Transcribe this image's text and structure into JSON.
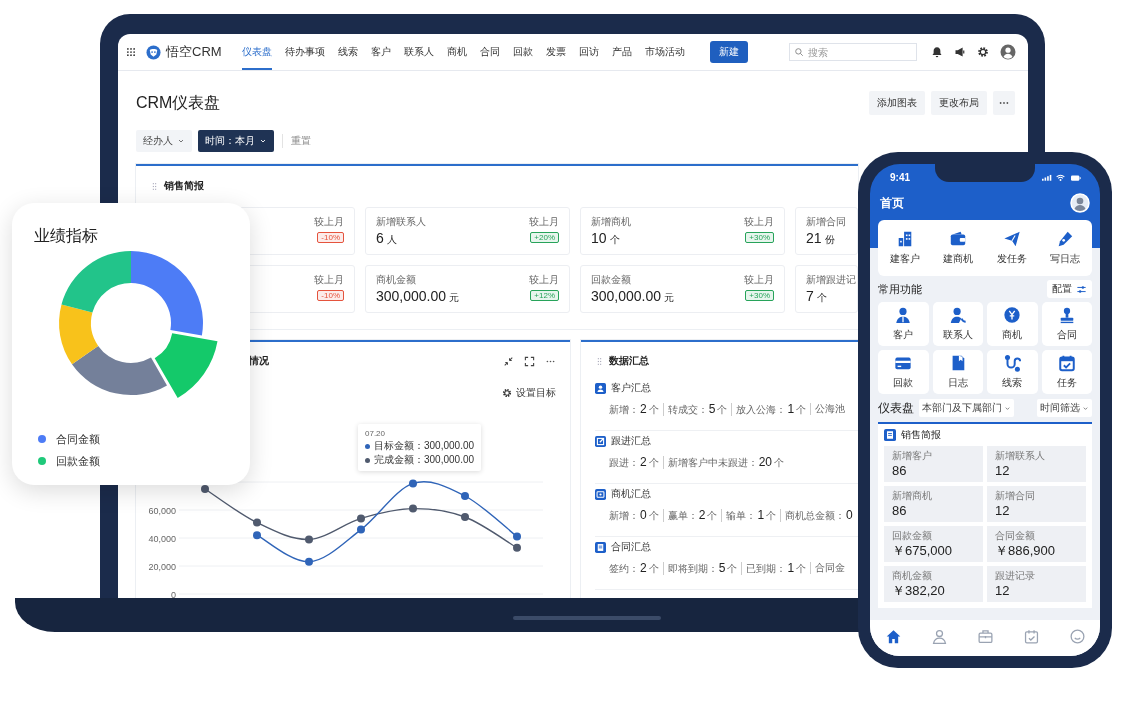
{
  "laptop": {
    "nav": {
      "app_name": "悟空CRM",
      "items": [
        {
          "label": "仪表盘",
          "selected": true
        },
        {
          "label": "待办事项",
          "selected": false
        },
        {
          "label": "线索",
          "selected": false
        },
        {
          "label": "客户",
          "selected": false
        },
        {
          "label": "联系人",
          "selected": false
        },
        {
          "label": "商机",
          "selected": false
        },
        {
          "label": "合同",
          "selected": false
        },
        {
          "label": "回款",
          "selected": false
        },
        {
          "label": "发票",
          "selected": false
        },
        {
          "label": "回访",
          "selected": false
        },
        {
          "label": "产品",
          "selected": false
        },
        {
          "label": "市场活动",
          "selected": false
        }
      ],
      "new_button": "新建",
      "search": {
        "placeholder": "搜索"
      }
    },
    "page": {
      "title": "CRM仪表盘",
      "actions": [
        "添加图表",
        "更改布局"
      ],
      "filters": [
        {
          "label": "经办人",
          "selected": false
        },
        {
          "label": "时间：本月",
          "selected": true
        }
      ],
      "reset": "重置"
    },
    "sales_report": {
      "title": "销售简报",
      "cards": [
        {
          "compare": "较上月",
          "change": "-10%",
          "color": "#e5533d"
        },
        {
          "title": "新增联系人",
          "value": "6",
          "unit": "人",
          "compare": "较上月",
          "change": "+20%",
          "color": "#27a35a"
        },
        {
          "title": "新增商机",
          "value": "10",
          "unit": "个",
          "compare": "较上月",
          "change": "+30%",
          "color": "#27a35a"
        },
        {
          "title": "新增合同",
          "value": "21",
          "unit": "份"
        },
        {
          "compare": "较上月",
          "change": "-10%",
          "color": "#e5533d"
        },
        {
          "title": "商机金额",
          "value": "300,000.00",
          "unit": "元",
          "compare": "较上月",
          "change": "+12%",
          "color": "#27a35a"
        },
        {
          "title": "回款金额",
          "value": "300,000.00",
          "unit": "元",
          "compare": "较上月",
          "change": "+30%",
          "color": "#27a35a"
        },
        {
          "title": "新增跟进记",
          "value": "7",
          "unit": "个"
        }
      ]
    },
    "trend_panel": {
      "title": "情况",
      "goal_button": "设置目标",
      "tooltip": {
        "date": "07.20",
        "values": [
          "：300,000.00",
          "：300,000.00"
        ]
      },
      "chart_data": {
        "type": "line",
        "grid": true,
        "ylim": [
          0,
          80000
        ],
        "yticks": [
          {
            "value": 0,
            "label": "0"
          },
          {
            "value": 20000,
            "label": "20,000"
          },
          {
            "value": 40000,
            "label": "40,000"
          },
          {
            "value": 60000,
            "label": "60,000"
          }
        ],
        "series": [
          {
            "name": "目标金额",
            "color": "#2f64b8",
            "marker": true,
            "values": [
              null,
              42000,
              23000,
              46000,
              79000,
              70000,
              41000
            ]
          },
          {
            "name": "完成金额",
            "color": "#505a6e",
            "marker": true,
            "values": [
              75000,
              51000,
              39000,
              54000,
              61000,
              55000,
              33000
            ]
          }
        ]
      }
    },
    "summary_panel": {
      "title": "数据汇总",
      "sections": [
        {
          "title": "客户汇总",
          "stats": [
            {
              "label": "新增：",
              "value": "2",
              "unit": "个"
            },
            {
              "label": "转成交：",
              "value": "5",
              "unit": "个"
            },
            {
              "label": "放入公海：",
              "value": "1",
              "unit": "个"
            },
            {
              "label": "公海池"
            }
          ]
        },
        {
          "title": "跟进汇总",
          "stats": [
            {
              "label": "跟进：",
              "value": "2",
              "unit": "个"
            },
            {
              "label": "新增客户中未跟进：",
              "value": "20",
              "unit": "个"
            }
          ]
        },
        {
          "title": "商机汇总",
          "stats": [
            {
              "label": "新增：",
              "value": "0",
              "unit": "个"
            },
            {
              "label": "赢单：",
              "value": "2",
              "unit": "个"
            },
            {
              "label": "输单：",
              "value": "1",
              "unit": "个"
            },
            {
              "label": "商机总金额：",
              "value": "0"
            }
          ]
        },
        {
          "title": "合同汇总",
          "stats": [
            {
              "label": "签约：",
              "value": "2",
              "unit": "个"
            },
            {
              "label": "即将到期：",
              "value": "5",
              "unit": "个"
            },
            {
              "label": "已到期：",
              "value": "1",
              "unit": "个"
            },
            {
              "label": "合同金"
            }
          ]
        }
      ]
    }
  },
  "overlay_card": {
    "title": "业绩指标",
    "legend": [
      {
        "label": "合同金额",
        "color": "#4d7cf6"
      },
      {
        "label": "回款金额",
        "color": "#1fc97a"
      }
    ]
  },
  "phone": {
    "time": "9:41",
    "title": "首页",
    "quick_actions": [
      "建客户",
      "建商机",
      "发任务",
      "写日志"
    ],
    "common": {
      "title": "常用功能",
      "config_button": "配置",
      "items": [
        "客户",
        "联系人",
        "商机",
        "合同",
        "回款",
        "日志",
        "线索",
        "任务"
      ]
    },
    "dashboard": {
      "title": "仪表盘",
      "dept_filter": "本部门及下属部门",
      "time_filter": "时间筛选"
    },
    "report": {
      "title": "销售简报",
      "tiles": [
        {
          "label": "新增客户",
          "value": "86"
        },
        {
          "label": "新增联系人",
          "value": "12"
        },
        {
          "label": "新增商机",
          "value": "86"
        },
        {
          "label": "新增合同",
          "value": "12"
        },
        {
          "label": "回款金额",
          "value": "￥675,000"
        },
        {
          "label": "合同金额",
          "value": "￥886,900"
        },
        {
          "label": "商机金额",
          "value": "￥382,20"
        },
        {
          "label": "跟进记录",
          "value": "12"
        }
      ]
    },
    "tabbar": [
      {
        "selected": true
      },
      {
        "selected": false
      },
      {
        "selected": false
      },
      {
        "selected": false
      },
      {
        "selected": false
      }
    ]
  }
}
